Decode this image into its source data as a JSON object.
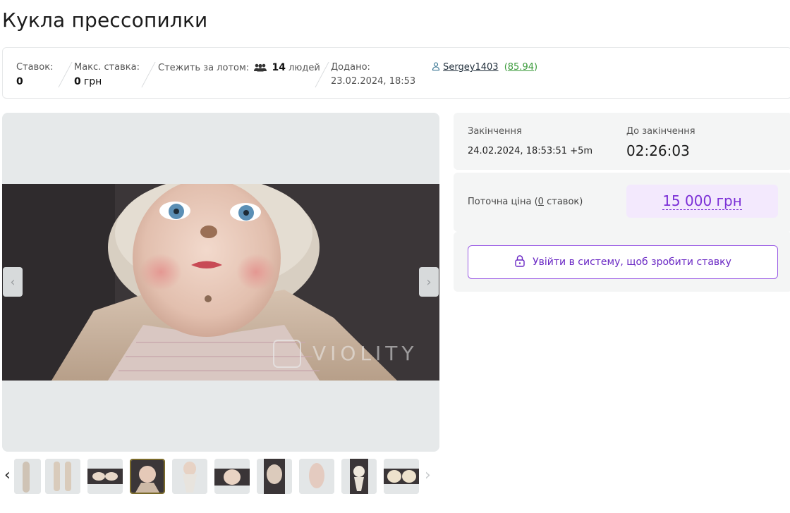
{
  "title": "Кукла прессопилки",
  "stats": {
    "bids_label": "Ставок:",
    "bids_value": "0",
    "max_bid_label": "Макс. ставка:",
    "max_bid_value": "0",
    "max_bid_currency": "грн",
    "watch_label": "Стежить за лотом:",
    "watch_count": "14",
    "watch_suffix": "людей",
    "added_label": "Додано:",
    "added_value": "23.02.2024, 18:53"
  },
  "seller": {
    "name": "Sergey1403",
    "rating": "85.94"
  },
  "watermark": "VIOLITY",
  "auction": {
    "end_label": "Закінчення",
    "end_value": "24.02.2024, 18:53:51 +5m",
    "countdown_label": "До закінчення",
    "countdown_value": "02:26:03",
    "current_price_label": "Поточна ціна (",
    "current_price_bids": "0",
    "current_price_suffix": "ставок)",
    "price": "15 000 грн",
    "login_button": "Увійти в систему, щоб зробити ставку"
  },
  "colors": {
    "accent": "#7b2fd6",
    "rating": "#3a9a3a",
    "panel_bg": "#f4f5f5"
  },
  "icons": [
    "user-icon",
    "people-icon",
    "lock-icon",
    "chevron-left-icon",
    "chevron-right-icon"
  ]
}
